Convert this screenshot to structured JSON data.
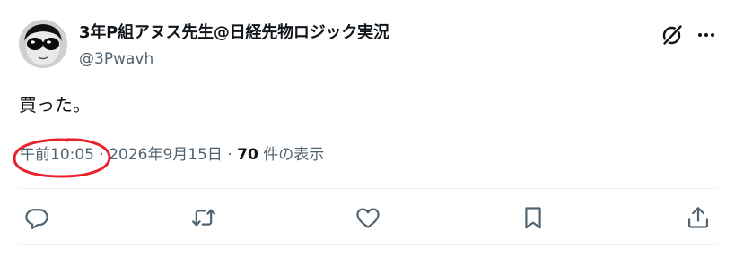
{
  "author": {
    "display_name": "3年P組アヌス先生@日経先物ロジック実況",
    "handle": "@3Pwavh",
    "avatar_icon": "sunglasses-avatar"
  },
  "header_icons": {
    "grok": "grok-icon",
    "more": "more-icon"
  },
  "tweet": {
    "text": "買った。"
  },
  "meta": {
    "time": "午前10:05",
    "separator_1": "·",
    "date": "2026年9月15日",
    "separator_2": "·",
    "views_count": "70",
    "views_label": "件の表示"
  },
  "annotation": {
    "circle_color": "#e8222b"
  },
  "actions": [
    {
      "name": "reply",
      "icon": "reply-icon"
    },
    {
      "name": "retweet",
      "icon": "retweet-icon"
    },
    {
      "name": "like",
      "icon": "like-icon"
    },
    {
      "name": "bookmark",
      "icon": "bookmark-icon"
    },
    {
      "name": "share",
      "icon": "share-icon"
    }
  ],
  "colors": {
    "text_primary": "#0f1419",
    "text_secondary": "#536471",
    "divider": "#eff3f4"
  }
}
